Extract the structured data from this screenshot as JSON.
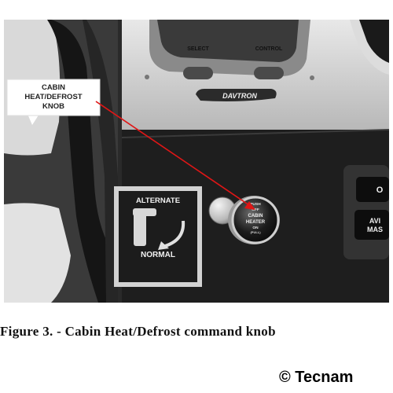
{
  "photo": {
    "callout_label": [
      "CABIN",
      "HEAT/DEFROST",
      "KNOB"
    ],
    "panel_buttons": [
      "SELECT",
      "CONTROL"
    ],
    "brand": "DAVTRON",
    "placard": {
      "top": "ALTERNATE",
      "bottom": "NORMAL"
    },
    "knob_text": [
      "PUSH",
      "OFF",
      "CABIN",
      "HEATER",
      "ON",
      "(PULL)"
    ],
    "right_edge_text": [
      "O",
      "AVI",
      "MAS"
    ]
  },
  "caption": "Figure 3. - Cabin Heat/Defrost command knob",
  "copyright": "© Tecnam",
  "colors": {
    "arrow": "#e01616",
    "callout_fill": "#ffffff"
  }
}
